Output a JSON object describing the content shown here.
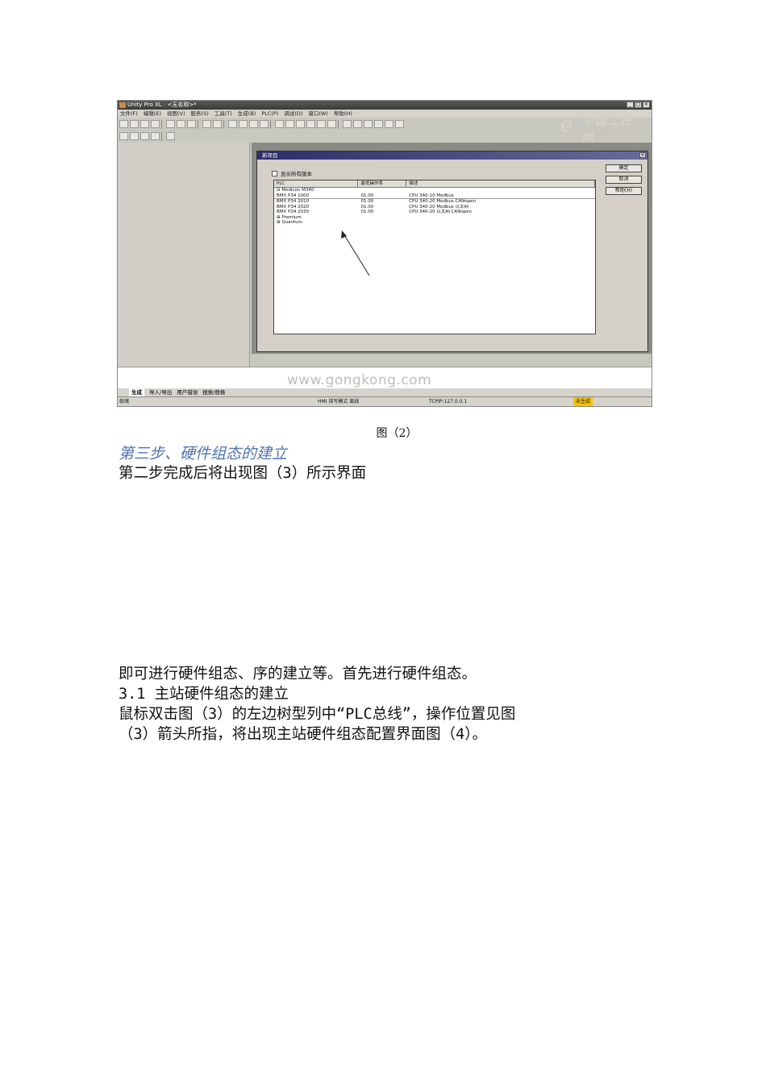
{
  "figure": {
    "window_title": "Unity Pro XL : <无名称>*",
    "menu": [
      "文件(F)",
      "编辑(E)",
      "视图(V)",
      "服务(S)",
      "工具(T)",
      "生成(B)",
      "PLC(P)",
      "调试(D)",
      "窗口(W)",
      "帮助(H)"
    ],
    "logo_text": "中国工控网",
    "logo_url": "www.gongkong.com",
    "dialog": {
      "title": "新项目",
      "show_all_label": "显示所有版本",
      "columns": [
        "PLC",
        "最低操作系",
        "描述"
      ],
      "rows": [
        {
          "plc": "⊟  Modicon M340",
          "os": "",
          "desc": ""
        },
        {
          "plc": "      BMX P34 1000",
          "os": "01.00",
          "desc": "CPU 340-10 Modbus"
        },
        {
          "plc": "      BMX P34 2010",
          "os": "01.00",
          "desc": "CPU 340-20 Modbus CANopen"
        },
        {
          "plc": "      BMX P34 2020",
          "os": "01.00",
          "desc": "CPU 340-20 Modbus 以太网"
        },
        {
          "plc": "      BMX P34 2030",
          "os": "01.00",
          "desc": "CPU 340-20 以太网 CANopen"
        },
        {
          "plc": "⊞  Premium",
          "os": "",
          "desc": ""
        },
        {
          "plc": "⊞  Quantum",
          "os": "",
          "desc": ""
        }
      ],
      "buttons": {
        "ok": "确定",
        "cancel": "取消",
        "help": "帮助(H)"
      }
    },
    "watermark": "www.gongkong.com",
    "tabs": [
      "生成",
      "导入/导出",
      "用户错误",
      "搜索/替换"
    ],
    "status": {
      "ready": "就绪",
      "mode": "HMI 读写模式  离线",
      "address": "TCPIP:127.0.0.1",
      "build": "未生成"
    }
  },
  "caption": "图（2）",
  "heading": "第三步、硬件组态的建立",
  "paragraphs": {
    "p1": "第二步完成后将出现图（3）所示界面",
    "p2": "即可进行硬件组态、序的建立等。首先进行硬件组态。",
    "p3": "3.1 主站硬件组态的建立",
    "p4": "鼠标双击图（3）的左边树型列中“PLC总线”，操作位置见图",
    "p5": "（3）箭头所指，将出现主站硬件组态配置界面图（4）。"
  }
}
